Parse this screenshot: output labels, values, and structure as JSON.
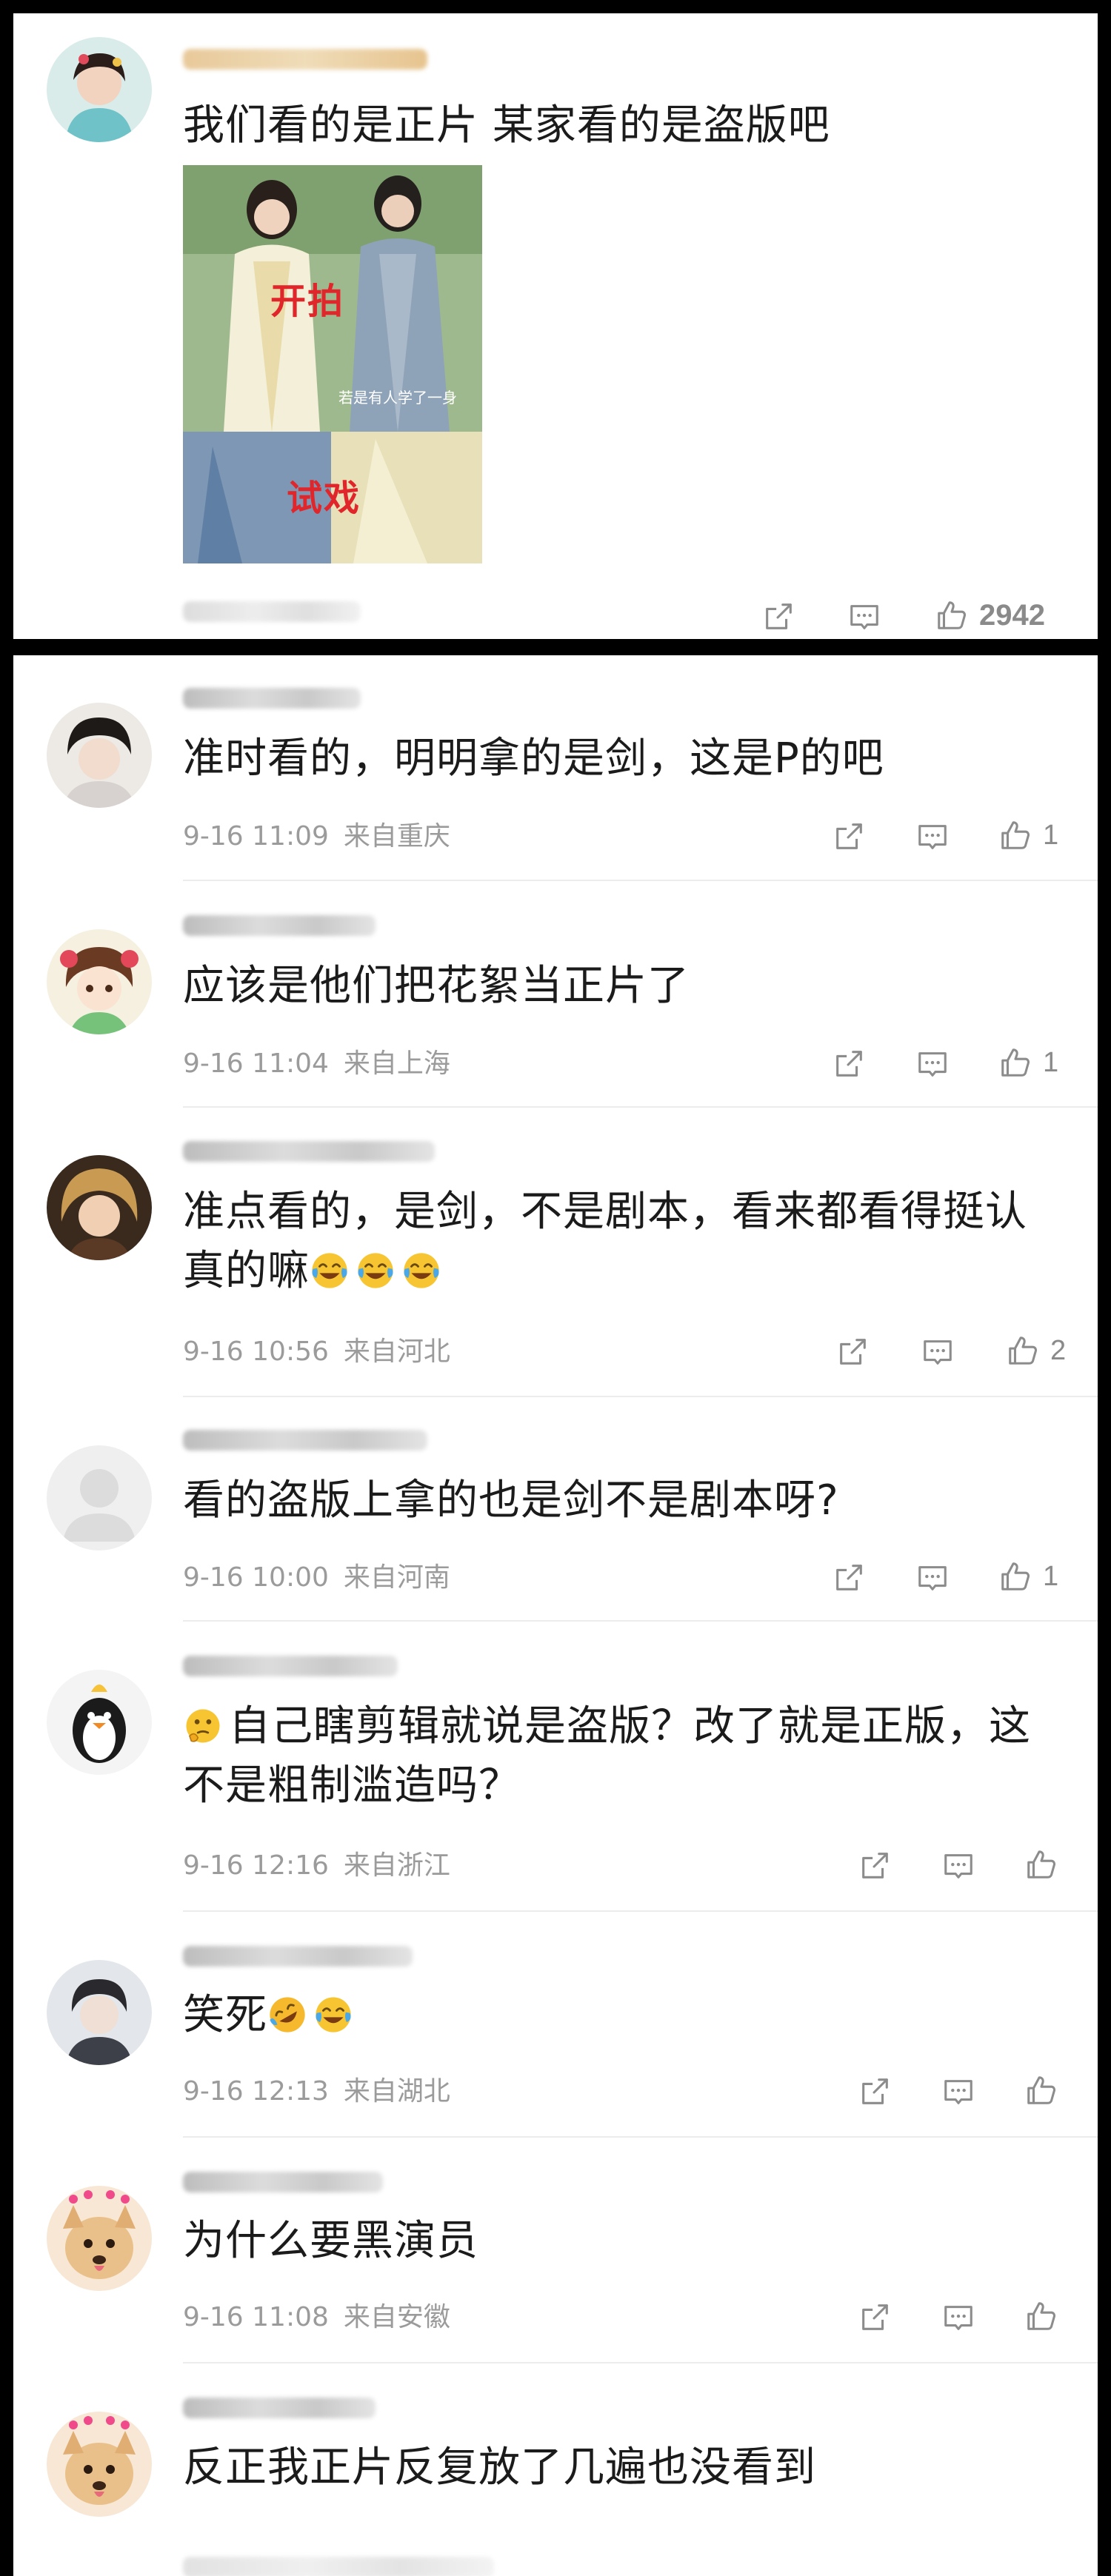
{
  "top_comment": {
    "text": "我们看的是正片  某家看的是盗版吧",
    "image": {
      "caption_top": "开拍",
      "caption_bottom": "试戏",
      "subtitle": "若是有人学了一身"
    },
    "like_count": "2942"
  },
  "comments": [
    {
      "text": "准时看的，明明拿的是剑，这是P的吧",
      "time": "9-16 11:09",
      "location": "来自重庆",
      "like_count": "1"
    },
    {
      "text": "应该是他们把花絮当正片了",
      "time": "9-16 11:04",
      "location": "来自上海",
      "like_count": "1"
    },
    {
      "text": "准点看的，是剑，不是剧本，看来都看得挺认真的嘛",
      "time": "9-16 10:56",
      "location": "来自河北",
      "like_count": "2"
    },
    {
      "text": "看的盗版上拿的也是剑不是剧本呀?",
      "time": "9-16 10:00",
      "location": "来自河南",
      "like_count": "1"
    },
    {
      "text": "自己瞎剪辑就说是盗版？改了就是正版，这不是粗制滥造吗？",
      "time": "9-16 12:16",
      "location": "来自浙江",
      "like_count": ""
    },
    {
      "text": "笑死",
      "time": "9-16 12:13",
      "location": "来自湖北",
      "like_count": ""
    },
    {
      "text": "为什么要黑演员",
      "time": "9-16 11:08",
      "location": "来自安徽",
      "like_count": ""
    },
    {
      "text": "反正我正片反复放了几遍也没看到",
      "time": "",
      "location": "",
      "like_count": ""
    }
  ],
  "icons": {
    "share": "share-icon",
    "comment": "comment-icon",
    "like": "thumbs-up-icon",
    "emoji_laugh_cry": "crying-laughing-emoji",
    "emoji_rofl": "rofl-emoji",
    "emoji_thinking": "thinking-emoji"
  },
  "colors": {
    "background": "#000000",
    "card": "#ffffff",
    "text": "#1b1b1b",
    "meta": "#9b9b9b",
    "caption_red": "#e0262a"
  }
}
